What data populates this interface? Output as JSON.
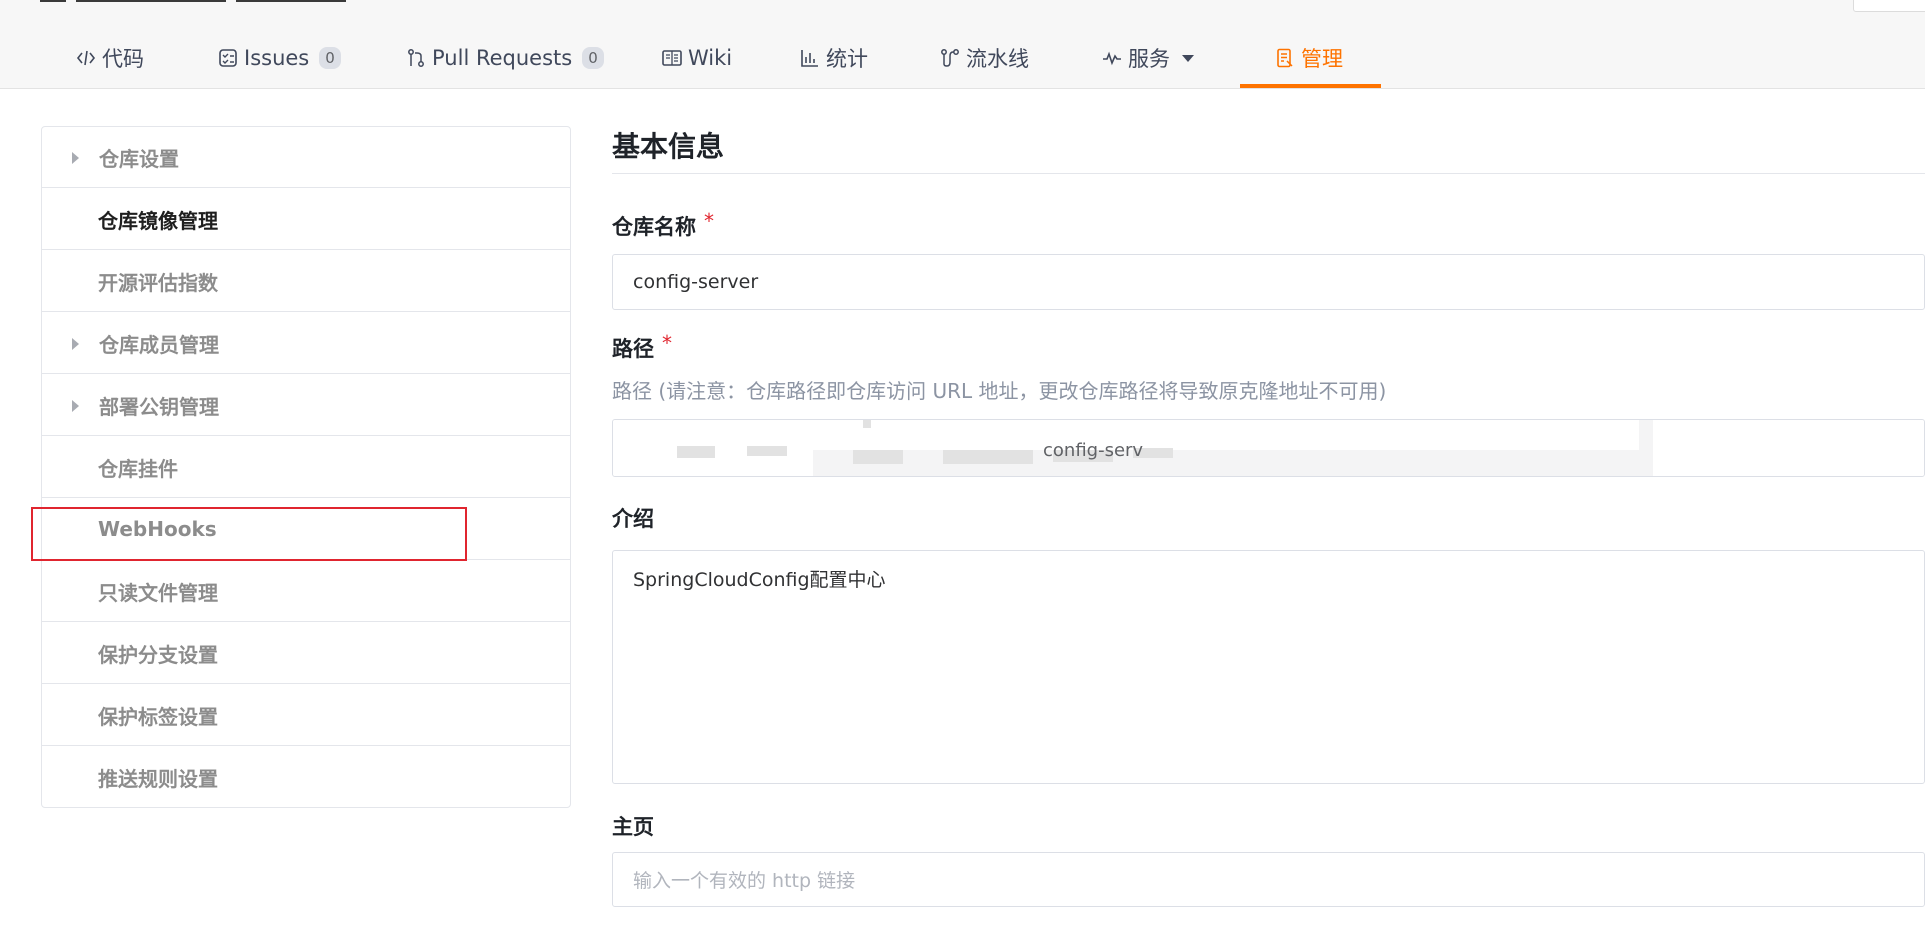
{
  "tabs": [
    {
      "label": "代码",
      "icon": "code-icon"
    },
    {
      "label": "Issues",
      "icon": "issues-icon",
      "badge": "0"
    },
    {
      "label": "Pull Requests",
      "icon": "pull-request-icon",
      "badge": "0"
    },
    {
      "label": "Wiki",
      "icon": "wiki-icon"
    },
    {
      "label": "统计",
      "icon": "stats-icon"
    },
    {
      "label": "流水线",
      "icon": "pipeline-icon"
    },
    {
      "label": "服务",
      "icon": "service-icon",
      "dropdown": true
    },
    {
      "label": "管理",
      "icon": "manage-icon",
      "active": true
    }
  ],
  "sidebar": {
    "items": [
      {
        "label": "仓库设置",
        "expandable": true
      },
      {
        "label": "仓库镜像管理",
        "active": true
      },
      {
        "label": "开源评估指数"
      },
      {
        "label": "仓库成员管理",
        "expandable": true
      },
      {
        "label": "部署公钥管理",
        "expandable": true
      },
      {
        "label": "仓库挂件"
      },
      {
        "label": "WebHooks",
        "highlighted": true
      },
      {
        "label": "只读文件管理"
      },
      {
        "label": "保护分支设置"
      },
      {
        "label": "保护标签设置"
      },
      {
        "label": "推送规则设置"
      }
    ]
  },
  "form": {
    "section_title": "基本信息",
    "name_label": "仓库名称",
    "required_mark": "*",
    "name_value": "config-server",
    "path_label": "路径",
    "path_hint": "路径 (请注意：仓库路径即仓库访问 URL 地址，更改仓库路径将导致原克隆地址不可用)",
    "path_value_visible": "config-serv",
    "intro_label": "介绍",
    "intro_value": "SpringCloudConfig配置中心",
    "homepage_label": "主页",
    "homepage_placeholder": "输入一个有效的 http 链接"
  },
  "colors": {
    "accent": "#fe7300",
    "required": "#e0252f",
    "highlight_box": "#e0252f"
  }
}
